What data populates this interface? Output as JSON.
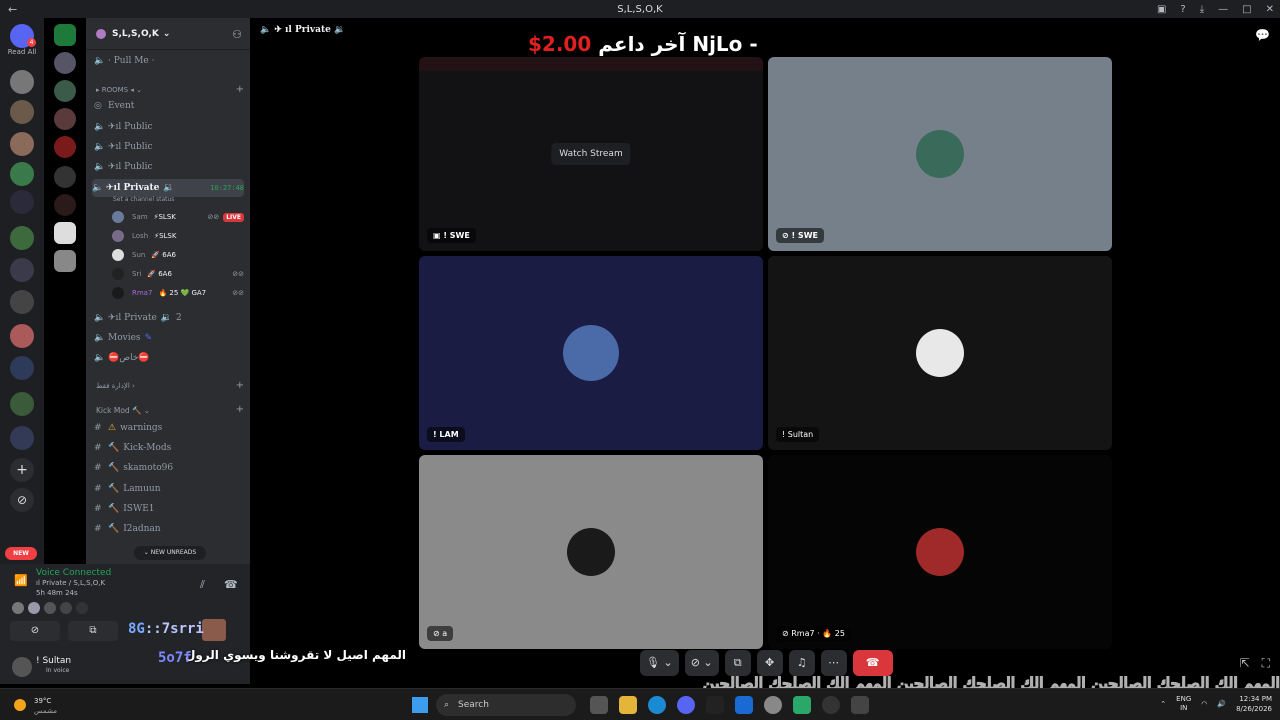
{
  "window": {
    "title": "S,L,S,O,K",
    "nav": "←"
  },
  "rail": {
    "read_all": "Read All",
    "dm_badge": "4"
  },
  "sidebar": {
    "server_name": "S,L,S,O,K",
    "channels": [
      {
        "name": "· Pull Me ·",
        "type": "voice"
      },
      {
        "name": "Event",
        "type": "stage"
      },
      {
        "name": "ıl Public",
        "type": "voice"
      },
      {
        "name": "ıl Public",
        "type": "voice"
      },
      {
        "name": "ıl Public",
        "type": "voice"
      }
    ],
    "rooms_category": "ROOMS",
    "active_channel": {
      "name": "ıl Private",
      "time": "10:27:48",
      "status_placeholder": "Set a channel status"
    },
    "members": [
      {
        "name": "Sam",
        "tag": "⚡SLSK",
        "live": "LIVE"
      },
      {
        "name": "Losh",
        "tag": "⚡SLSK"
      },
      {
        "name": "Sun",
        "tag": "🚀 6A6"
      },
      {
        "name": "Sri",
        "tag": "🚀 6A6"
      },
      {
        "name": "Rma7",
        "tag": "🔥 25 💚 GA7"
      }
    ],
    "private2": {
      "name": "ıl Private",
      "count": "2"
    },
    "movies": "Movies",
    "khas": "خاص",
    "admin_category": "الإدارة فقط",
    "kick_category": "Kick Mod",
    "text_channels": [
      "warnings",
      "Kick-Mods",
      "skamoto96",
      "Lamuun",
      "ISWE1",
      "I2adnan"
    ],
    "new_unreads": "NEW UNREADS",
    "new_pill": "NEW"
  },
  "voice_panel": {
    "status": "Voice Connected",
    "location": "ıl Private / S,L,S,O,K",
    "elapsed": "5h 48m 24s",
    "user": "! Sultan",
    "user_status": "In voice",
    "srri": "::7srri"
  },
  "stage": {
    "header": "ıl Private",
    "donor_label": "آخر داعم NjLo -",
    "donor_amount": "$2.00",
    "watch_stream": "Watch Stream",
    "caption": "المهم اصيل لا تقروشنا ويسوي الرول",
    "caption_tag": "5o7f",
    "tiles": [
      {
        "label": "! SWE",
        "bg": "#121214"
      },
      {
        "label": "! SWE",
        "bg": "#76808a"
      },
      {
        "label": "! LAM",
        "bg": "#1a1c44"
      },
      {
        "label": "! Sultan",
        "bg": "#141414"
      },
      {
        "label": "a",
        "bg": "#8a8a8a"
      },
      {
        "label": "Rma7 · 🔥 25",
        "bg": "#050505"
      }
    ]
  },
  "taskbar": {
    "temp": "39°C",
    "weather_desc": "مشمس",
    "search_placeholder": "Search",
    "lang": "ENG",
    "lang_sub": "IN",
    "time": "12:34 PM",
    "date": "8/26/2026"
  },
  "overlay_text": "المهم الك الصلحك الصالحين     المهم الك الصلحك الصالحين     المهم الك الصلحك الصالحين"
}
